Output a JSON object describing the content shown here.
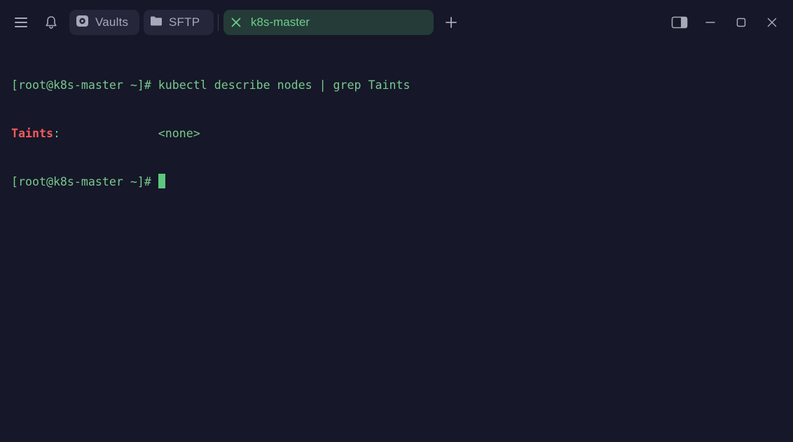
{
  "titlebar": {
    "vaults_label": "Vaults",
    "sftp_label": "SFTP",
    "active_tab_label": "k8s-master",
    "icons": {
      "menu": "hamburger-menu-icon",
      "notifications": "bell-icon",
      "vaults": "vault-icon",
      "sftp": "folder-icon",
      "close_tab": "close-icon",
      "new_tab": "plus-icon",
      "sidebar_toggle": "sidebar-panel-icon",
      "minimize": "minimize-icon",
      "maximize": "maximize-icon",
      "close_window": "close-window-icon"
    }
  },
  "terminal": {
    "line1": {
      "prompt": "[root@k8s-master ~]# ",
      "command": "kubectl describe nodes | grep Taints"
    },
    "line2": {
      "key": "Taints",
      "rest": ":              <none>"
    },
    "line3": {
      "prompt": "[root@k8s-master ~]# "
    }
  },
  "colors": {
    "background": "#161728",
    "pill_background": "#25263a",
    "active_tab_background": "#243b37",
    "accent_green": "#6ccd8d",
    "error_red": "#f25b5b"
  }
}
